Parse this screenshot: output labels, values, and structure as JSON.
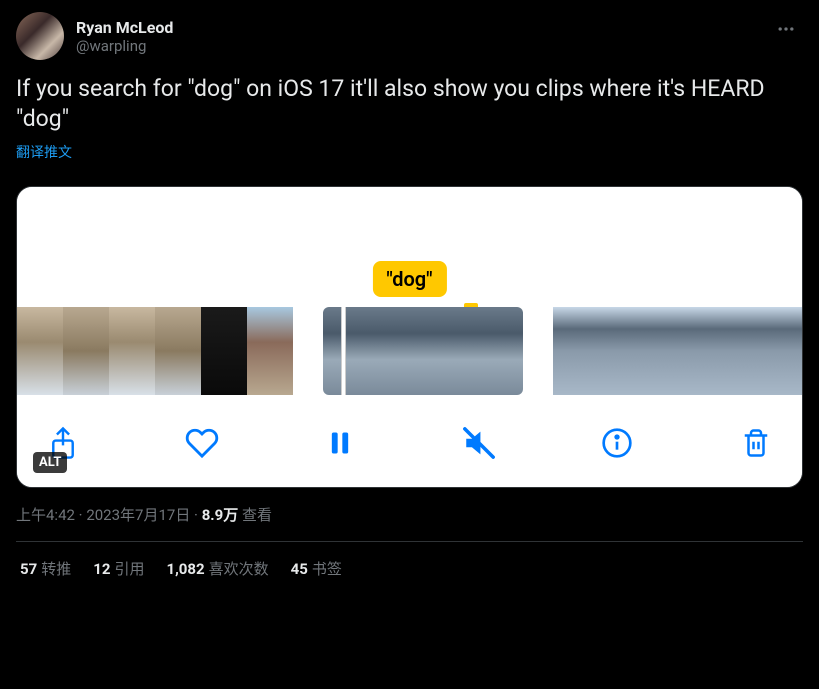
{
  "user": {
    "display_name": "Ryan McLeod",
    "handle": "@warpling"
  },
  "tweet_text": "If you search for \"dog\" on iOS 17 it'll also show you clips where it's HEARD \"dog\"",
  "translate_label": "翻译推文",
  "media": {
    "search_match_label": "\"dog\"",
    "alt_badge": "ALT"
  },
  "timestamp": {
    "time": "上午4:42",
    "date": "2023年7月17日",
    "views_count": "8.9万",
    "views_label": "查看"
  },
  "stats": {
    "retweets_count": "57",
    "retweets_label": "转推",
    "quotes_count": "12",
    "quotes_label": "引用",
    "likes_count": "1,082",
    "likes_label": "喜欢次数",
    "bookmarks_count": "45",
    "bookmarks_label": "书签"
  }
}
